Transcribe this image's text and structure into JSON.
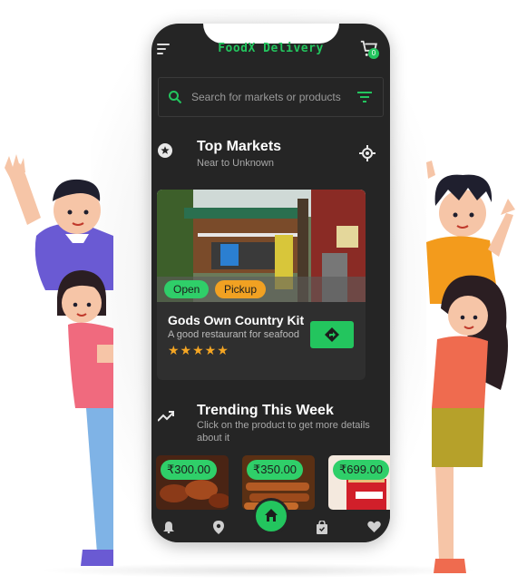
{
  "header": {
    "app_title": "FoodX Delivery",
    "cart_count": "0"
  },
  "search": {
    "placeholder": "Search for markets or products"
  },
  "top_markets": {
    "title": "Top Markets",
    "subtitle": "Near to Unknown"
  },
  "market_card": {
    "name": "Gods Own Country Kitchen",
    "description": "A good restaurant for seafood",
    "status_tag": "Open",
    "mode_tag": "Pickup",
    "rating": "★★★★★"
  },
  "trending": {
    "title": "Trending This Week",
    "subtitle": "Click on the product to get more details about it"
  },
  "products": [
    {
      "price": "₹300.00"
    },
    {
      "price": "₹350.00"
    },
    {
      "price": "₹699.00"
    }
  ],
  "bottom_nav": [
    "notifications",
    "map",
    "home",
    "orders",
    "favorites"
  ],
  "colors": {
    "accent": "#23c55e",
    "background": "#252525",
    "star": "#f5a623",
    "pickup": "#f1a122"
  },
  "icons": {
    "menu": "menu-icon",
    "cart": "cart-icon",
    "search": "search-icon",
    "filter": "filter-icon",
    "star": "star-icon",
    "location": "my-location-icon",
    "directions": "directions-icon",
    "trending": "trending-up-icon",
    "bell": "bell-icon",
    "pin": "map-pin-icon",
    "home": "home-icon",
    "bag": "shopping-bag-icon",
    "heart": "heart-icon"
  }
}
